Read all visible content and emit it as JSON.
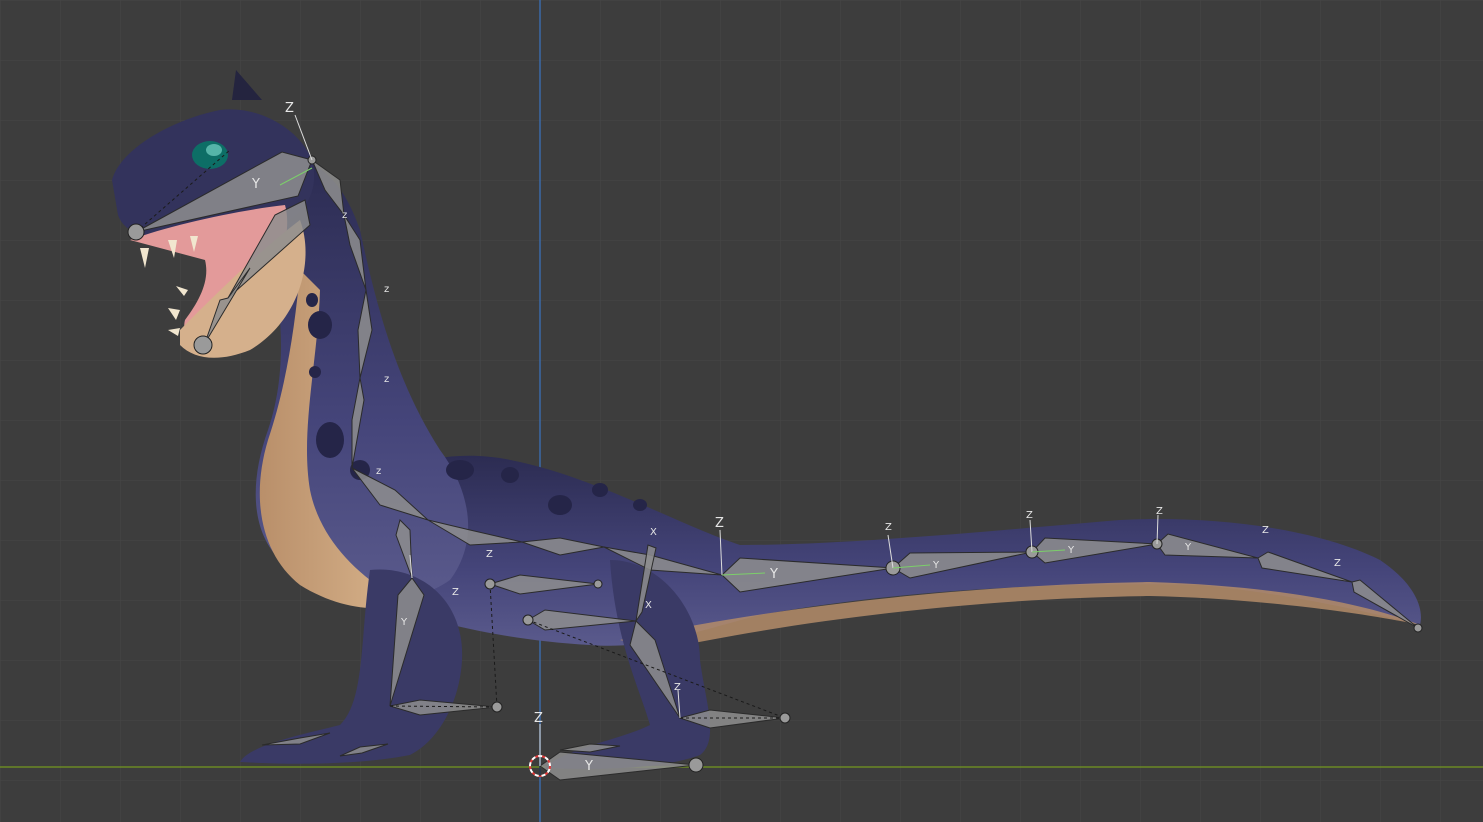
{
  "viewport": {
    "background_color": "#3d3d3d",
    "grid_color": "#474747",
    "x_axis_color": "#6b8a25",
    "z_axis_color": "#3b6aa8",
    "model_body_color": "#3c3c66",
    "model_belly_color": "#c9a27a",
    "model_mouth_color": "#e39a9a",
    "bone_fill_color": "#8e8e8e",
    "axis_gizmo_labels": {
      "z": "Z",
      "y": "Y",
      "x": "X",
      "small_z": "z"
    }
  }
}
